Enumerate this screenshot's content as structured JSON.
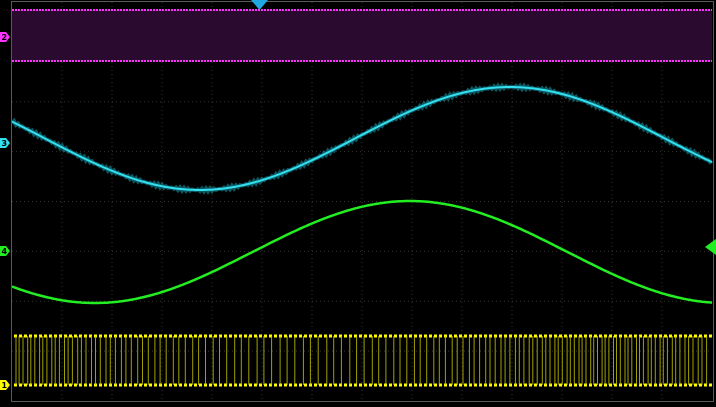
{
  "screen": {
    "background": "#000000",
    "grid_color": "#2a2a2a",
    "frame_color": "#5a5a5a"
  },
  "trigger": {
    "icon": "trigger-position-icon",
    "color": "#20a8e0"
  },
  "channels": [
    {
      "id": "ch1",
      "label": "1",
      "name": "channel-1",
      "color": "#ffff00",
      "marker_side": "left"
    },
    {
      "id": "ch2",
      "label": "2",
      "name": "channel-2",
      "color": "#ff33ff",
      "marker_side": "left"
    },
    {
      "id": "ch3",
      "label": "3",
      "name": "channel-3",
      "color": "#33e0f0",
      "marker_side": "left"
    },
    {
      "id": "ch4",
      "label": "4",
      "name": "channel-4",
      "color": "#22ee22",
      "marker_side": "left"
    }
  ],
  "trigger_level_marker": {
    "icon": "trigger-level-icon",
    "color": "#22ee22"
  }
}
